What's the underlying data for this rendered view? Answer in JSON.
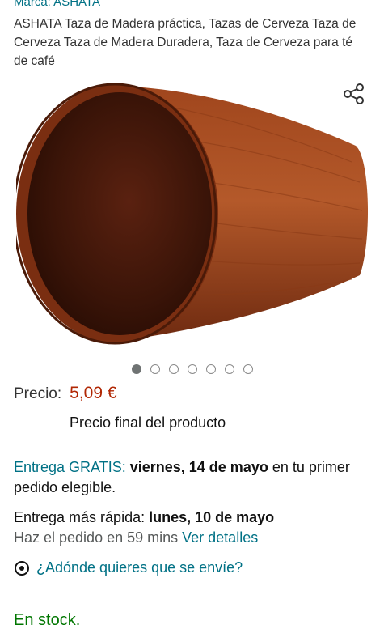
{
  "product": {
    "brand": "Marca: ASHATA",
    "title": "ASHATA Taza de Madera práctica, Tazas de Cerveza Taza de Cerveza Taza de Madera Duradera, Taza de Cerveza para té de café"
  },
  "gallery": {
    "image_count": 7,
    "active_index": 0
  },
  "pricing": {
    "label": "Precio:",
    "value": "5,09 €",
    "note": "Precio final del producto"
  },
  "delivery": {
    "free_label": "Entrega GRATIS:",
    "free_date": "viernes, 14 de mayo",
    "free_suffix": "en tu primer pedido elegible.",
    "fast_label": "Entrega más rápida:",
    "fast_date": "lunes, 10 de mayo",
    "order_within": "Haz el pedido en 59 mins",
    "details_link": "Ver detalles",
    "location_prompt": "¿Adónde quieres que se envíe?"
  },
  "availability": {
    "stock": "En stock."
  },
  "icons": {
    "share": "share-icon",
    "location": "location-pin-icon"
  },
  "colors": {
    "link": "#007185",
    "price": "#b12704",
    "stock": "#007600"
  }
}
